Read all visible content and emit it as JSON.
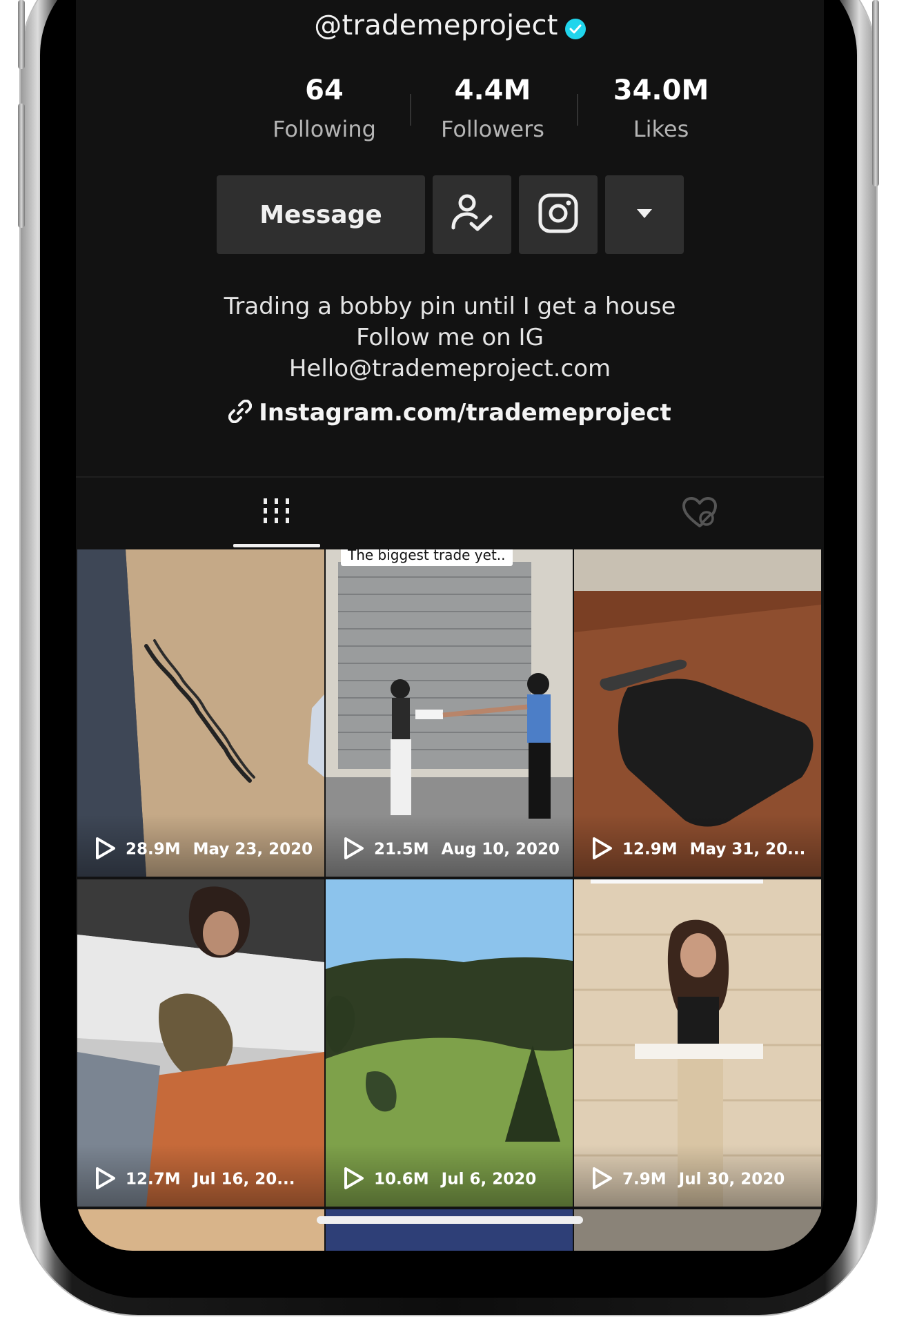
{
  "profile": {
    "username": "@trademeproject",
    "stats": [
      {
        "value": "64",
        "label": "Following"
      },
      {
        "value": "4.4M",
        "label": "Followers"
      },
      {
        "value": "34.0M",
        "label": "Likes"
      }
    ],
    "message_label": "Message",
    "bio": [
      "Trading a bobby pin until I get a house",
      "Follow me on IG",
      "Hello@trademeproject.com"
    ],
    "link": "Instagram.com/trademeproject"
  },
  "videos": [
    {
      "views": "28.9M",
      "date": "May 23, 2020"
    },
    {
      "views": "21.5M",
      "date": "Aug 10, 2020",
      "caption": "The biggest trade yet.."
    },
    {
      "views": "12.9M",
      "date": "May 31, 20..."
    },
    {
      "views": "12.7M",
      "date": "Jul 16, 20..."
    },
    {
      "views": "10.6M",
      "date": "Jul 6, 2020"
    },
    {
      "views": "7.9M",
      "date": "Jul 30, 2020"
    }
  ],
  "colors": {
    "background": "#121212",
    "button": "#2f2f2f",
    "verified": "#20d5ec"
  }
}
